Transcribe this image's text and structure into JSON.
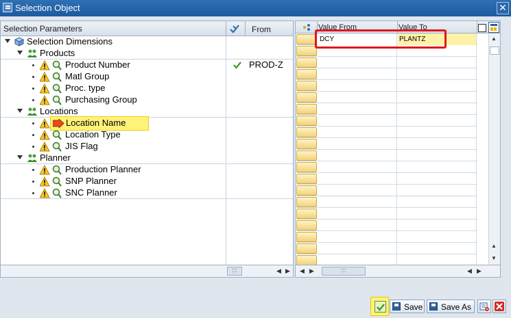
{
  "window": {
    "title": "Selection Object",
    "close_glyph": "✕"
  },
  "left": {
    "header_col1": "Selection Parameters",
    "header_col2": "From",
    "tree": {
      "root": "Selection Dimensions",
      "groups": [
        {
          "label": "Products",
          "items": [
            "Product Number",
            "Matl Group",
            "Proc. type",
            "Purchasing Group"
          ]
        },
        {
          "label": "Locations",
          "items": [
            "Location Name",
            "Location Type",
            "JIS Flag"
          ]
        },
        {
          "label": "Planner",
          "items": [
            "Production Planner",
            "SNP Planner",
            "SNC Planner"
          ]
        }
      ],
      "selected_item": "Location Name"
    },
    "from_value": "PROD-Z",
    "scroll_glyph": ":::"
  },
  "right": {
    "header_col1": "Value From",
    "header_col2": "Value To",
    "first_row": {
      "from": "DCY",
      "to": "PLANTZ"
    },
    "scroll_glyph": ":::"
  },
  "toolbar": {
    "save_label": "Save",
    "save_as_label": "Save As"
  },
  "icons": [
    "window-icon",
    "close-icon",
    "expand-icon",
    "cube-icon",
    "people-icon",
    "warning-icon",
    "search-icon",
    "check-icon",
    "arrow-icon",
    "settings-icon",
    "copy-icon",
    "delete-icon",
    "cancel-icon"
  ],
  "colors": {
    "titlebar": "#1d5aa0",
    "highlight": "#fff27a",
    "red_frame": "#e0151c",
    "button_gold": "#f3d27a"
  }
}
